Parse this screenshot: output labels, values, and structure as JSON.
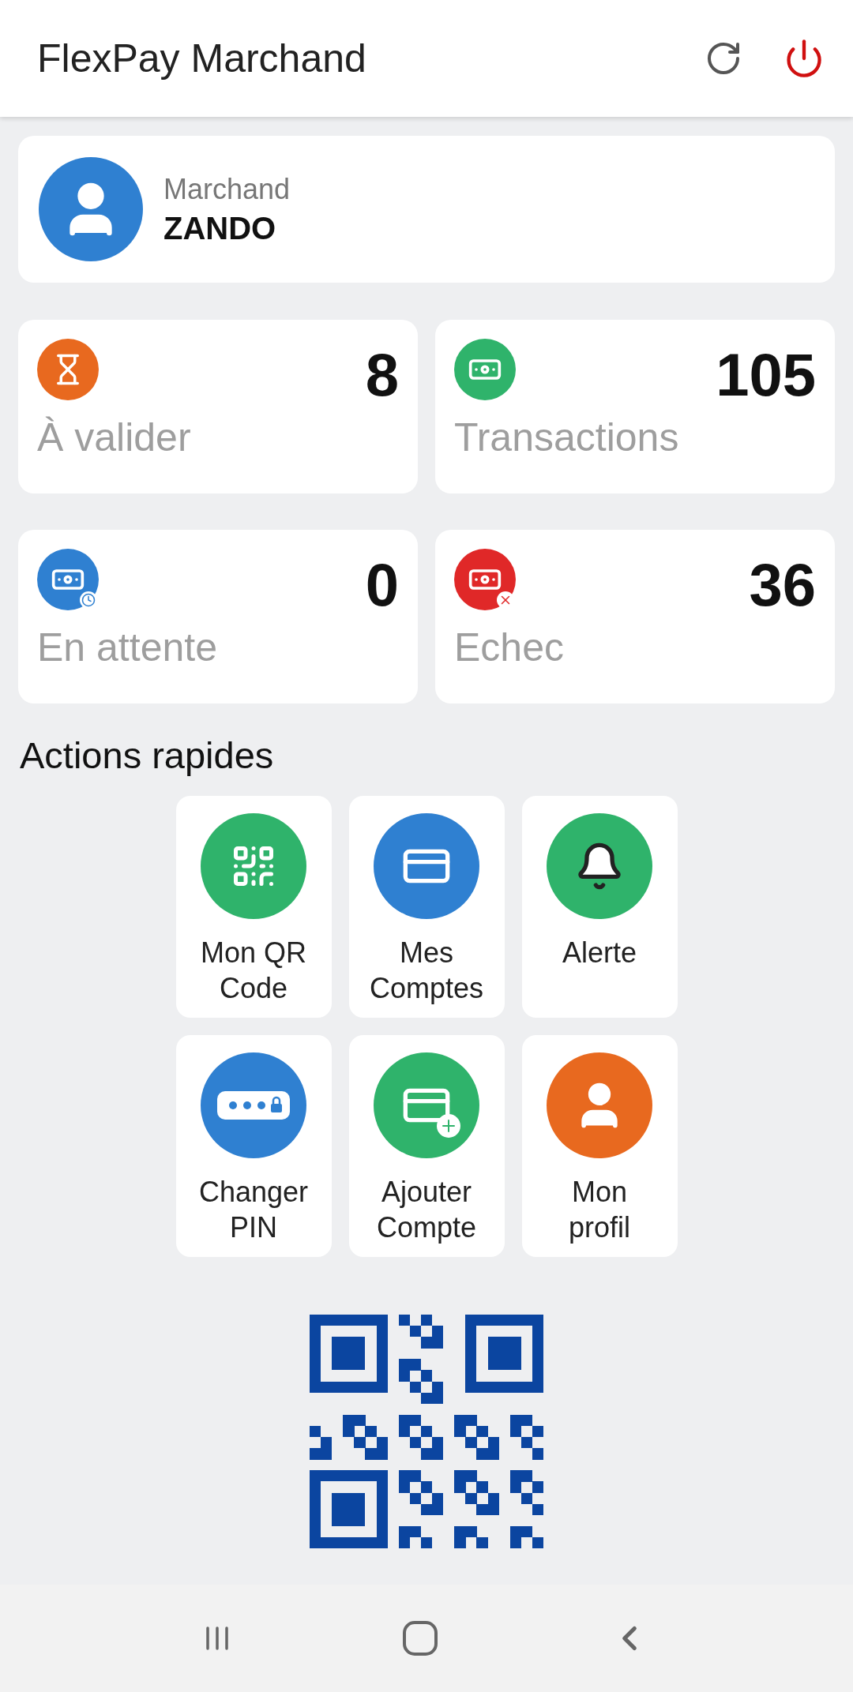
{
  "app_bar": {
    "title": "FlexPay Marchand"
  },
  "merchant": {
    "label": "Marchand",
    "name": "ZANDO"
  },
  "stats": [
    {
      "kind": "pending",
      "value": "8",
      "label": "À valider",
      "color": "#e8691f"
    },
    {
      "kind": "transactions",
      "value": "105",
      "label": "Transactions",
      "color": "#2fb36b"
    },
    {
      "kind": "waiting",
      "value": "0",
      "label": "En attente",
      "color": "#2f80d1"
    },
    {
      "kind": "failed",
      "value": "36",
      "label": "Echec",
      "color": "#e02828"
    }
  ],
  "quick_actions": {
    "title": "Actions rapides",
    "items": [
      {
        "kind": "qr",
        "label": "Mon QR Code",
        "color": "#2fb36b"
      },
      {
        "kind": "accounts",
        "label": "Mes Comptes",
        "color": "#2f80d1"
      },
      {
        "kind": "alert",
        "label": "Alerte",
        "color": "#2fb36b"
      },
      {
        "kind": "pin",
        "label": "Changer PIN",
        "color": "#2f80d1"
      },
      {
        "kind": "add_account",
        "label": "Ajouter Compte",
        "color": "#2fb36b"
      },
      {
        "kind": "profile",
        "label": "Mon profil",
        "color": "#e8691f"
      }
    ]
  }
}
